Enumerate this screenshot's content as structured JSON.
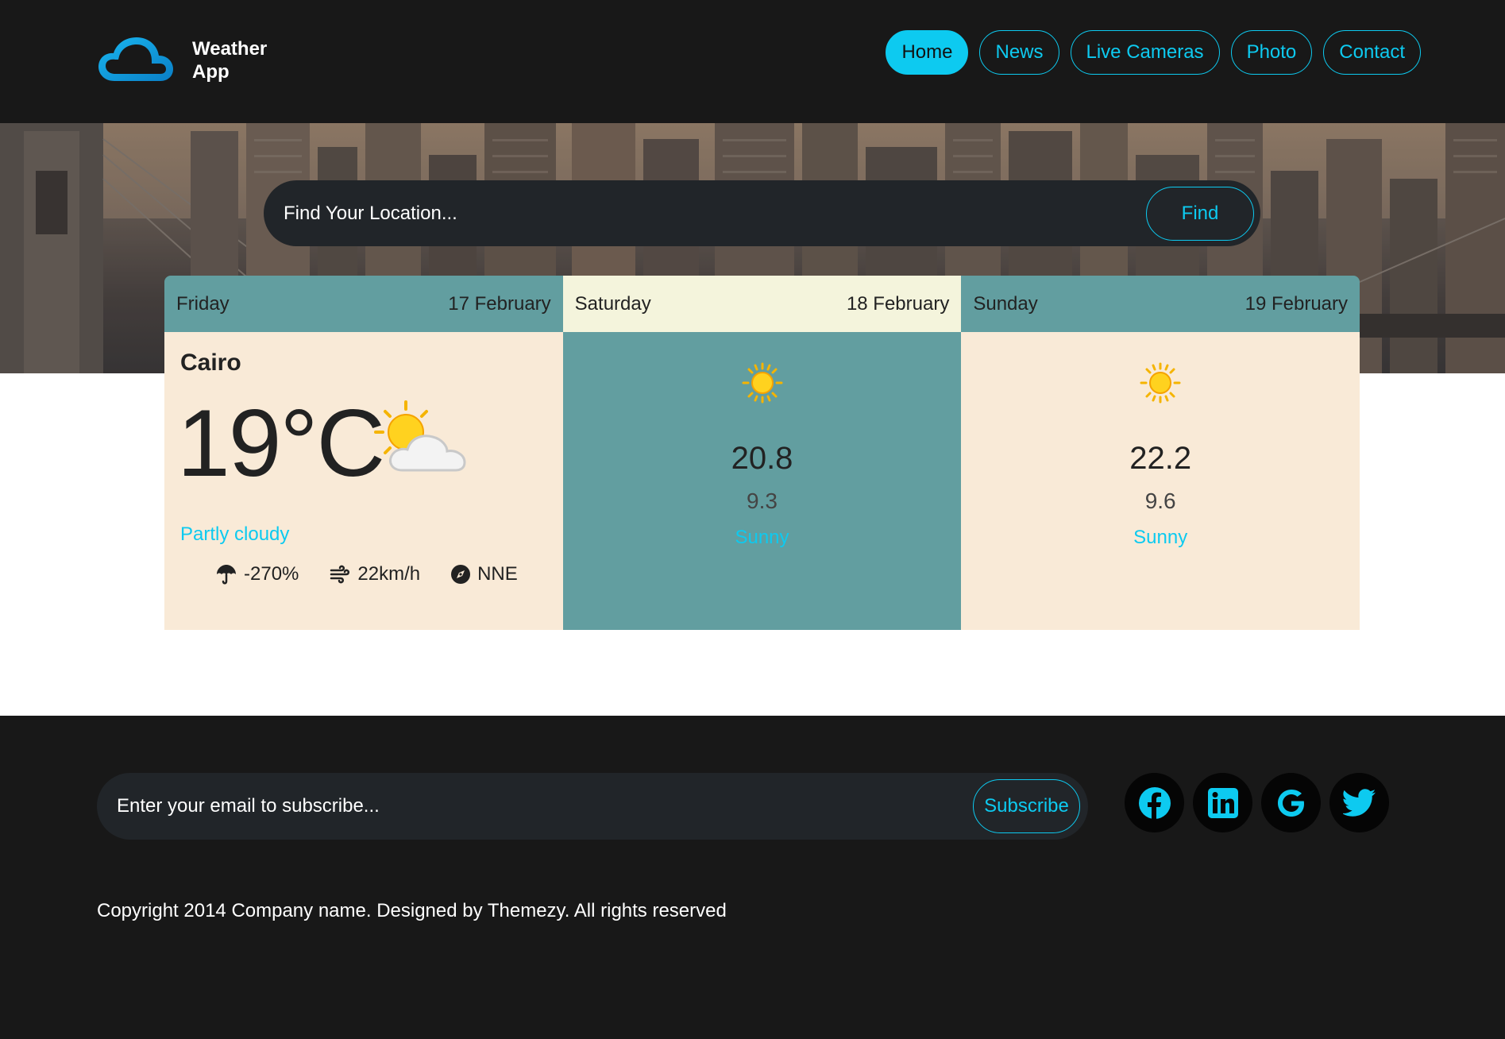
{
  "app": {
    "name": "Weather App",
    "name_line1": "Weather",
    "name_line2": "App"
  },
  "nav": {
    "items": [
      {
        "label": "Home",
        "active": true
      },
      {
        "label": "News",
        "active": false
      },
      {
        "label": "Live Cameras",
        "active": false
      },
      {
        "label": "Photo",
        "active": false
      },
      {
        "label": "Contact",
        "active": false
      }
    ]
  },
  "search": {
    "placeholder": "Find Your Location...",
    "button_label": "Find"
  },
  "forecast": {
    "today": {
      "day": "Friday",
      "date": "17 February",
      "city": "Cairo",
      "temperature": "19°C",
      "icon": "partly-cloudy-icon",
      "condition": "Partly cloudy",
      "rain": "-270%",
      "wind_speed": "22km/h",
      "wind_direction": "NNE"
    },
    "days": [
      {
        "day": "Saturday",
        "date": "18 February",
        "icon": "sun-icon",
        "max": "20.8",
        "min": "9.3",
        "condition": "Sunny"
      },
      {
        "day": "Sunday",
        "date": "19 February",
        "icon": "sun-icon",
        "max": "22.2",
        "min": "9.6",
        "condition": "Sunny"
      }
    ]
  },
  "footer": {
    "subscribe_placeholder": "Enter your email to subscribe...",
    "subscribe_button": "Subscribe",
    "socials": [
      "facebook-icon",
      "linkedin-icon",
      "google-icon",
      "twitter-icon"
    ],
    "copyright": "Copyright 2014 Company name. Designed by Themezy. All rights reserved"
  },
  "colors": {
    "accent": "#0dcaf0",
    "background": "#181818",
    "card_teal": "#629ea0",
    "card_cream": "#f9ead7",
    "header_light": "#f4f4dc"
  }
}
